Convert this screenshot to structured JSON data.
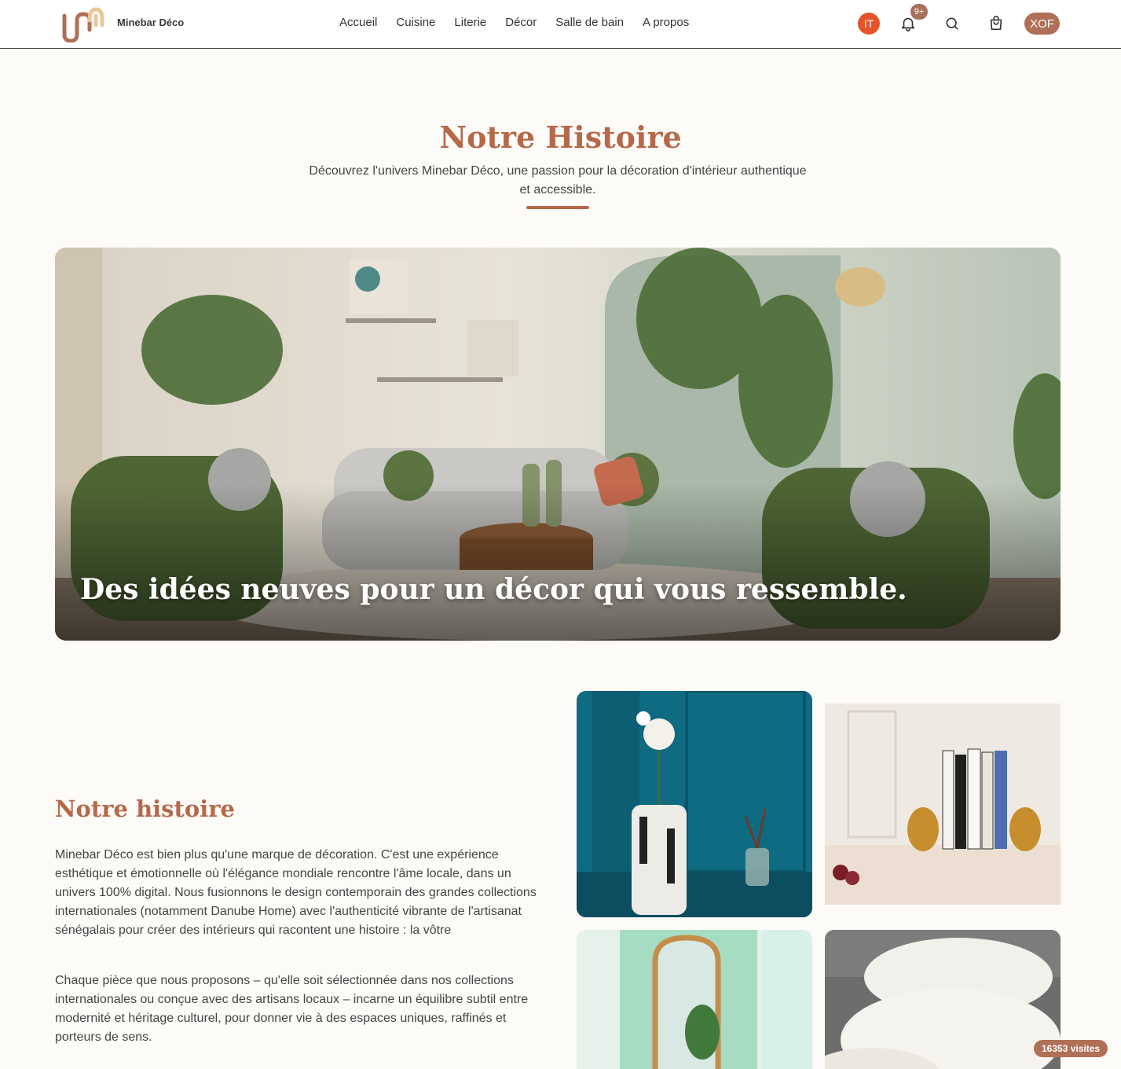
{
  "header": {
    "brand": "Minebar Déco",
    "nav": [
      "Accueil",
      "Cuisine",
      "Literie",
      "Décor",
      "Salle de bain",
      "A propos"
    ],
    "avatar_initials": "IT",
    "notification_count": "9+",
    "currency": "XOF"
  },
  "hero": {
    "title": "Notre Histoire",
    "subtitle": "Découvrez l'univers Minebar Déco, une passion pour la décoration d'intérieur authentique et accessible."
  },
  "banner": {
    "caption": "Des idées neuves pour un décor qui vous ressemble."
  },
  "story": {
    "title": "Notre histoire",
    "paragraphs": [
      "Minebar Déco est bien plus qu'une marque de décoration. C'est une expérience esthétique et émotionnelle où l'élégance mondiale rencontre l'âme locale, dans un univers 100% digital. Nous fusionnons le design contemporain des grandes collections internationales (notamment Danube Home) avec l'authenticité vibrante de l'artisanat sénégalais pour créer des intérieurs qui racontent une histoire : la vôtre",
      "Chaque pièce que nous proposons – qu'elle soit sélectionnée dans nos collections internationales ou conçue avec des artisans locaux – incarne un équilibre subtil entre modernité et héritage culturel, pour donner vie à des espaces uniques, raffinés et porteurs de sens."
    ]
  },
  "visits": "16353 visites",
  "colors": {
    "accent": "#b5694a",
    "notification": "#e6532a"
  }
}
